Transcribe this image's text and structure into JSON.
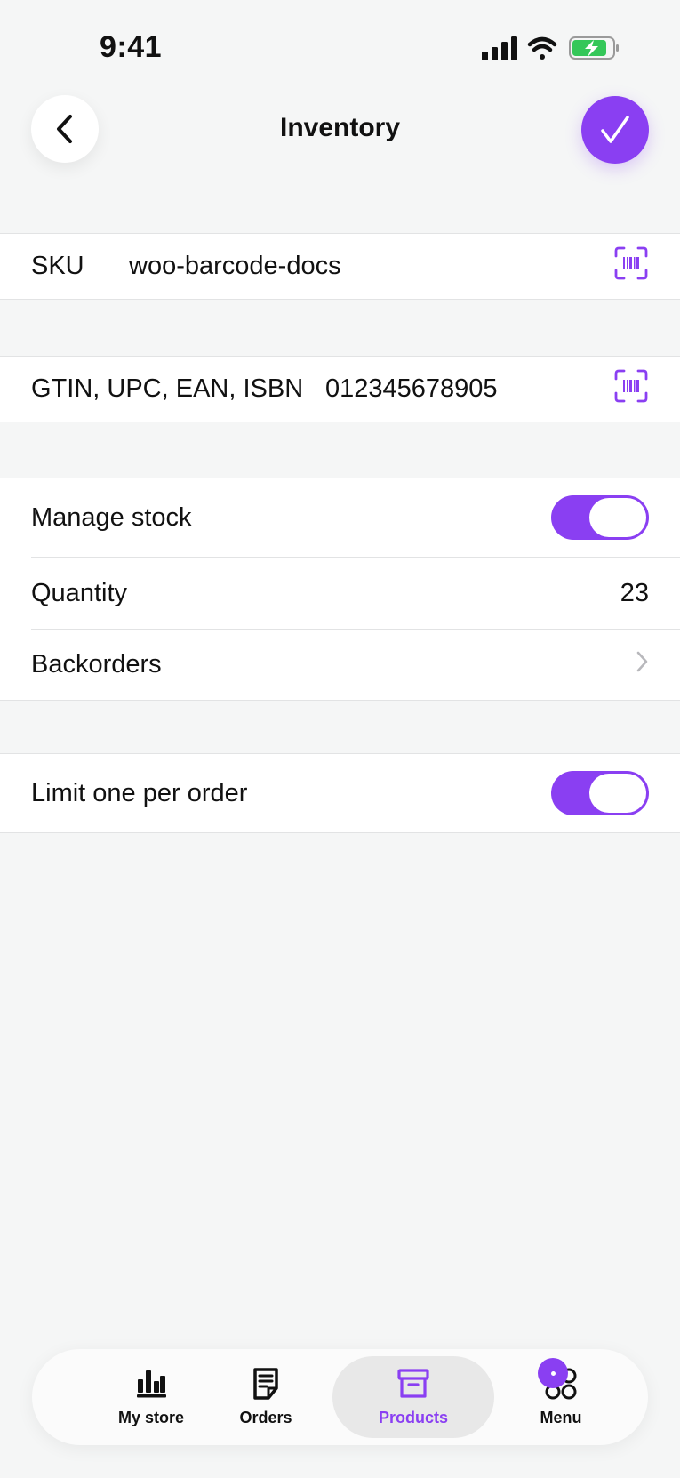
{
  "status_bar": {
    "time": "9:41"
  },
  "header": {
    "title": "Inventory"
  },
  "sku": {
    "label": "SKU",
    "value": "woo-barcode-docs"
  },
  "gtin": {
    "label": "GTIN, UPC, EAN, ISBN",
    "value": "012345678905"
  },
  "stock": {
    "manage_label": "Manage stock",
    "manage_enabled": true,
    "quantity_label": "Quantity",
    "quantity_value": "23",
    "backorders_label": "Backorders"
  },
  "limit": {
    "label": "Limit one per order",
    "enabled": true
  },
  "tabs": [
    {
      "label": "My store",
      "icon": "bar-chart-icon"
    },
    {
      "label": "Orders",
      "icon": "orders-icon"
    },
    {
      "label": "Products",
      "icon": "products-box-icon",
      "active": true
    },
    {
      "label": "Menu",
      "icon": "menu-grid-icon"
    }
  ],
  "colors": {
    "accent": "#8a3ff2",
    "background": "#f5f6f6",
    "battery": "#34c759"
  }
}
